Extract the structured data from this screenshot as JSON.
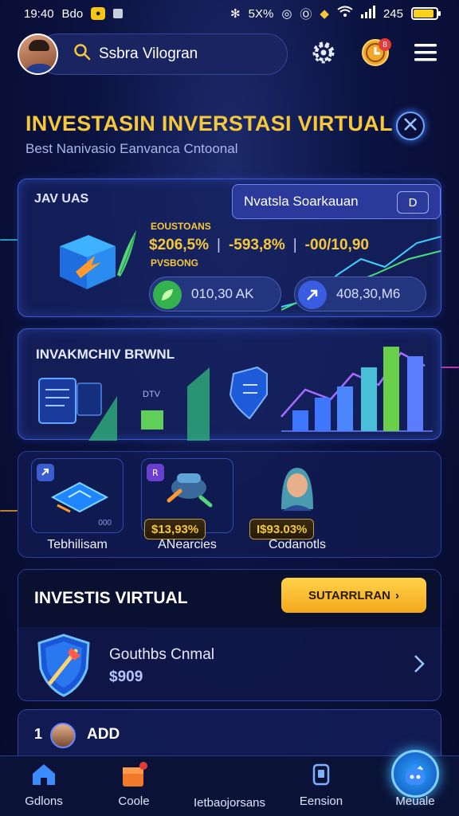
{
  "status_bar": {
    "time": "19:40",
    "carrier": "Bdo",
    "signal_text": "5X%",
    "battery_text": "245",
    "battery_level": 0.9
  },
  "header": {
    "search_text": "Ssbra Vilogran",
    "coin_badge": "8"
  },
  "hero": {
    "title": "INVESTASIN INVERSTASI VIRTUAL",
    "subtitle": "Best Nanivasio Eanvanca Cntoonal"
  },
  "summary": {
    "label": "JAV UAS",
    "search_pill": "Nvatsla Soarkauan",
    "search_pill_btn": "D",
    "stat_label_top": "EOUSTOANS",
    "stat_label_bottom": "PVSBONG",
    "stats": [
      "$206,5%",
      "-593,8%",
      "-00/10,90"
    ],
    "pill_left": "010,30 AK",
    "pill_right": "408,30,M6"
  },
  "chart_card": {
    "title": "INVAKMCHIV BRWNL",
    "small_label": "DTV"
  },
  "features": [
    {
      "label": "Tebhilisam",
      "value": "",
      "tile_code": "000"
    },
    {
      "label": "ANearcies",
      "value": "$13,93%"
    },
    {
      "label": "Codanotls",
      "value": "I$93.03%"
    }
  ],
  "invest": {
    "title": "INVESTIS VIRTUAL",
    "cta": "SUTARRLRAN",
    "item_name": "Gouthbs Cnmal",
    "item_value": "$909"
  },
  "next_card": {
    "index": "1",
    "label": "ADD"
  },
  "bottom_nav": [
    {
      "label": "Gdlons"
    },
    {
      "label": "Coole"
    },
    {
      "label": "Ietbaojorsans"
    },
    {
      "label": "Eension"
    },
    {
      "label": "Meuale"
    }
  ],
  "colors": {
    "accent_gold": "#f5c83b",
    "accent_blue": "#3e5ad0",
    "background": "#0b1240"
  }
}
